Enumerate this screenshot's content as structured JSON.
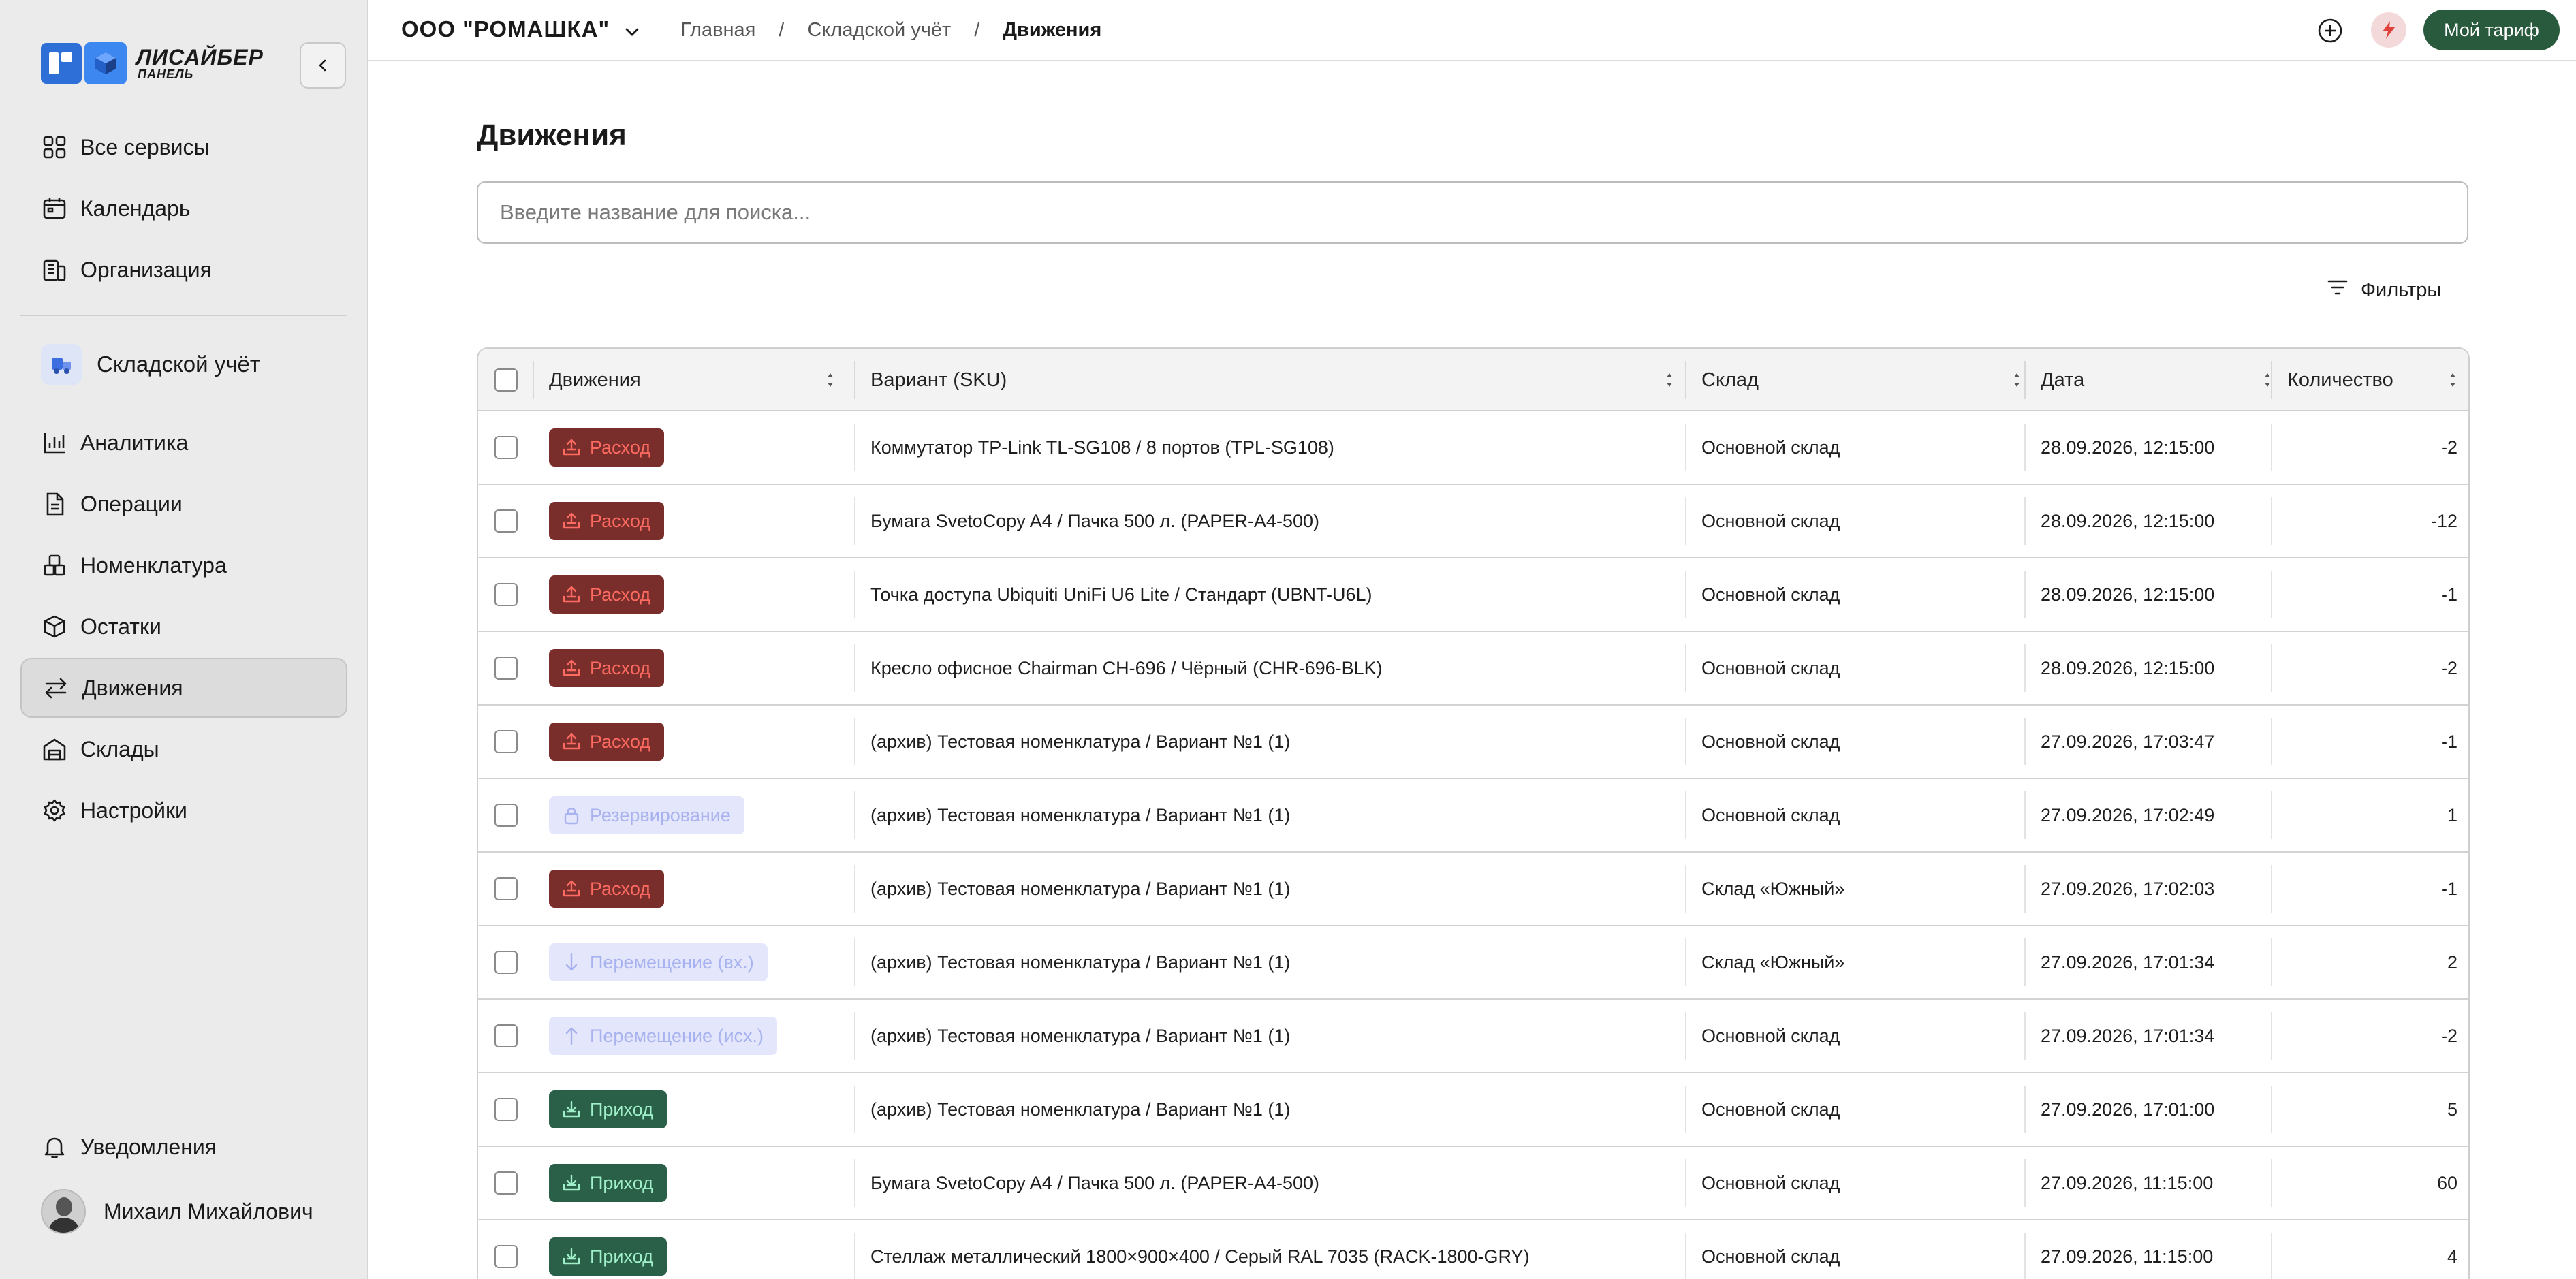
{
  "sidebar": {
    "logo": {
      "line1": "ЛИСАЙБЕР",
      "line2": "ПАНЕЛЬ"
    },
    "top_items": [
      {
        "label": "Все сервисы",
        "icon": "grid-icon"
      },
      {
        "label": "Календарь",
        "icon": "calendar-icon"
      },
      {
        "label": "Организация",
        "icon": "building-icon"
      }
    ],
    "module": {
      "label": "Складской учёт",
      "icon": "truck-icon"
    },
    "module_items": [
      {
        "label": "Аналитика",
        "icon": "chart-icon"
      },
      {
        "label": "Операции",
        "icon": "document-icon"
      },
      {
        "label": "Номенклатура",
        "icon": "boxes-icon"
      },
      {
        "label": "Остатки",
        "icon": "cube-icon"
      },
      {
        "label": "Движения",
        "icon": "arrows-swap-icon",
        "active": true
      },
      {
        "label": "Склады",
        "icon": "warehouse-icon"
      },
      {
        "label": "Настройки",
        "icon": "gear-icon"
      }
    ],
    "notifications": {
      "label": "Уведомления",
      "icon": "bell-icon"
    },
    "user": {
      "name": "Михаил Михайлович"
    }
  },
  "header": {
    "org": "ООО \"РОМАШКА\"",
    "breadcrumb": [
      "Главная",
      "Складской учёт",
      "Движения"
    ],
    "tariff_button": "Мой тариф"
  },
  "main": {
    "title": "Движения",
    "search_placeholder": "Введите название для поиска...",
    "filters_label": "Фильтры",
    "columns": [
      "Движения",
      "Вариант (SKU)",
      "Склад",
      "Дата",
      "Количество"
    ],
    "rows": [
      {
        "type": "out",
        "movement": "Расход",
        "sku": "Коммутатор TP-Link TL-SG108 / 8 портов (TPL-SG108)",
        "warehouse": "Основной склад",
        "date": "28.09.2026, 12:15:00",
        "qty": "-2"
      },
      {
        "type": "out",
        "movement": "Расход",
        "sku": "Бумага SvetoCopy A4 / Пачка 500 л. (PAPER-A4-500)",
        "warehouse": "Основной склад",
        "date": "28.09.2026, 12:15:00",
        "qty": "-12"
      },
      {
        "type": "out",
        "movement": "Расход",
        "sku": "Точка доступа Ubiquiti UniFi U6 Lite / Стандарт (UBNT-U6L)",
        "warehouse": "Основной склад",
        "date": "28.09.2026, 12:15:00",
        "qty": "-1"
      },
      {
        "type": "out",
        "movement": "Расход",
        "sku": "Кресло офисное Chairman CH-696 / Чёрный (CHR-696-BLK)",
        "warehouse": "Основной склад",
        "date": "28.09.2026, 12:15:00",
        "qty": "-2"
      },
      {
        "type": "out",
        "movement": "Расход",
        "sku": "(архив) Тестовая номенклатура / Вариант №1 (1)",
        "warehouse": "Основной склад",
        "date": "27.09.2026, 17:03:47",
        "qty": "-1"
      },
      {
        "type": "res",
        "movement": "Резервирование",
        "sku": "(архив) Тестовая номенклатура / Вариант №1 (1)",
        "warehouse": "Основной склад",
        "date": "27.09.2026, 17:02:49",
        "qty": "1"
      },
      {
        "type": "out",
        "movement": "Расход",
        "sku": "(архив) Тестовая номенклатура / Вариант №1 (1)",
        "warehouse": "Склад «Южный»",
        "date": "27.09.2026, 17:02:03",
        "qty": "-1"
      },
      {
        "type": "mov-in",
        "movement": "Перемещение (вх.)",
        "sku": "(архив) Тестовая номенклатура / Вариант №1 (1)",
        "warehouse": "Склад «Южный»",
        "date": "27.09.2026, 17:01:34",
        "qty": "2"
      },
      {
        "type": "mov-out",
        "movement": "Перемещение (исх.)",
        "sku": "(архив) Тестовая номенклатура / Вариант №1 (1)",
        "warehouse": "Основной склад",
        "date": "27.09.2026, 17:01:34",
        "qty": "-2"
      },
      {
        "type": "in",
        "movement": "Приход",
        "sku": "(архив) Тестовая номенклатура / Вариант №1 (1)",
        "warehouse": "Основной склад",
        "date": "27.09.2026, 17:01:00",
        "qty": "5"
      },
      {
        "type": "in",
        "movement": "Приход",
        "sku": "Бумага SvetoCopy A4 / Пачка 500 л. (PAPER-A4-500)",
        "warehouse": "Основной склад",
        "date": "27.09.2026, 11:15:00",
        "qty": "60"
      },
      {
        "type": "in",
        "movement": "Приход",
        "sku": "Стеллаж металлический 1800×900×400 / Серый RAL 7035 (RACK-1800-GRY)",
        "warehouse": "Основной склад",
        "date": "27.09.2026, 11:15:00",
        "qty": "4"
      }
    ]
  },
  "colors": {
    "accent_green": "#2a5a3d",
    "out_bg": "#7a2e2c",
    "out_text": "#ff6b61",
    "in_bg": "#2a5f48",
    "in_text": "#9ff0c8",
    "muted_bg": "#e4e7fb",
    "muted_text": "#a7b2ef"
  }
}
